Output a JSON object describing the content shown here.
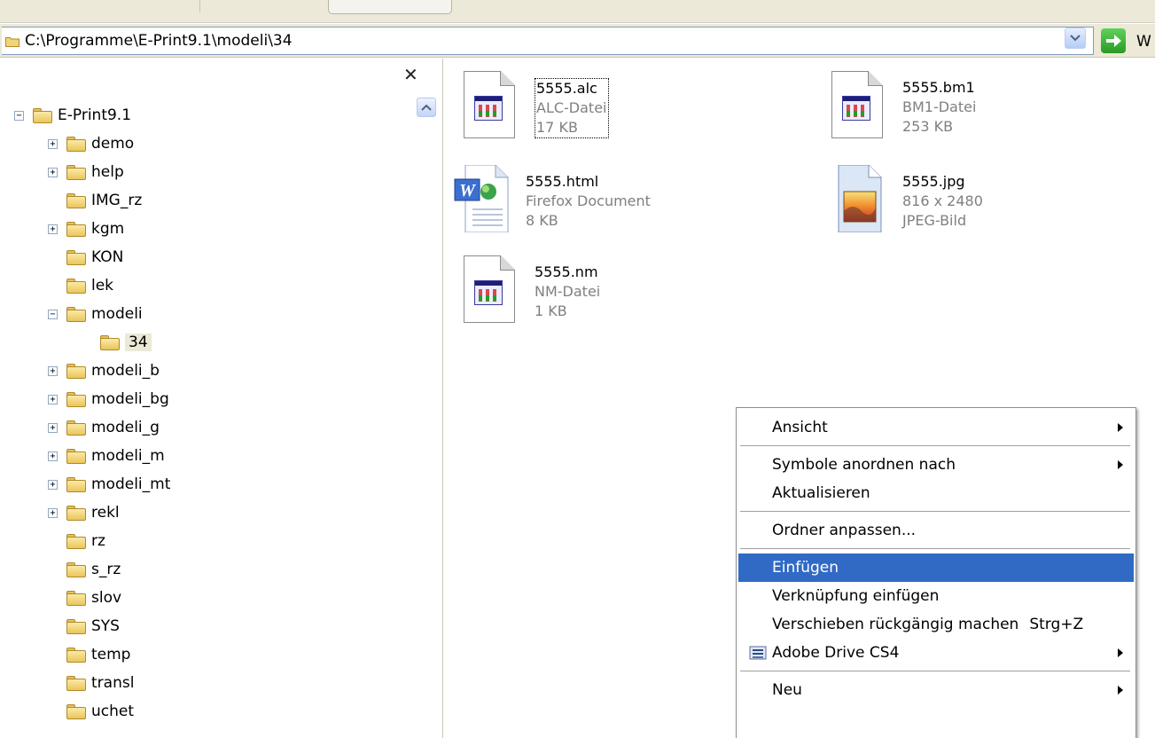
{
  "address": {
    "path": "C:\\Programme\\E-Print9.1\\modeli\\34",
    "go_label": "W"
  },
  "left_pane": {
    "close_label": "✕",
    "tree": [
      {
        "label": "E-Print9.1",
        "expander": "−",
        "level": 0
      },
      {
        "label": "demo",
        "expander": "+",
        "level": 1
      },
      {
        "label": "help",
        "expander": "+",
        "level": 1
      },
      {
        "label": "IMG_rz",
        "expander": "",
        "level": 1
      },
      {
        "label": "kgm",
        "expander": "+",
        "level": 1
      },
      {
        "label": "KON",
        "expander": "",
        "level": 1
      },
      {
        "label": "lek",
        "expander": "",
        "level": 1
      },
      {
        "label": "modeli",
        "expander": "−",
        "level": 1
      },
      {
        "label": "34",
        "expander": "",
        "level": 2,
        "selected": true
      },
      {
        "label": "modeli_b",
        "expander": "+",
        "level": 1
      },
      {
        "label": "modeli_bg",
        "expander": "+",
        "level": 1
      },
      {
        "label": "modeli_g",
        "expander": "+",
        "level": 1
      },
      {
        "label": "modeli_m",
        "expander": "+",
        "level": 1
      },
      {
        "label": "modeli_mt",
        "expander": "+",
        "level": 1
      },
      {
        "label": "rekl",
        "expander": "+",
        "level": 1
      },
      {
        "label": "rz",
        "expander": "",
        "level": 1
      },
      {
        "label": "s_rz",
        "expander": "",
        "level": 1
      },
      {
        "label": "slov",
        "expander": "",
        "level": 1
      },
      {
        "label": "SYS",
        "expander": "",
        "level": 1
      },
      {
        "label": "temp",
        "expander": "",
        "level": 1
      },
      {
        "label": "transl",
        "expander": "",
        "level": 1
      },
      {
        "label": "uchet",
        "expander": "",
        "level": 1
      }
    ]
  },
  "files": [
    {
      "name": "5555.alc",
      "type": "ALC-Datei",
      "size": "17 KB",
      "icon": "app-document-icon",
      "focused": true
    },
    {
      "name": "5555.bm1",
      "type": "BM1-Datei",
      "size": "253 KB",
      "icon": "app-document-icon"
    },
    {
      "name": "5555.html",
      "type": "Firefox Document",
      "size": "8 KB",
      "icon": "word-html-document-icon"
    },
    {
      "name": "5555.jpg",
      "type": "816 x 2480",
      "size": "JPEG-Bild",
      "icon": "jpeg-image-icon"
    },
    {
      "name": "5555.nm",
      "type": "NM-Datei",
      "size": "1 KB",
      "icon": "app-document-icon"
    }
  ],
  "context_menu": {
    "items": [
      {
        "label": "Ansicht",
        "submenu": true
      },
      {
        "separator": true
      },
      {
        "label": "Symbole anordnen nach",
        "submenu": true
      },
      {
        "label": "Aktualisieren"
      },
      {
        "separator": true
      },
      {
        "label": "Ordner anpassen..."
      },
      {
        "separator": true
      },
      {
        "label": "Einfügen",
        "highlighted": true
      },
      {
        "label": "Verknüpfung einfügen"
      },
      {
        "label": "Verschieben rückgängig machen",
        "shortcut": "Strg+Z"
      },
      {
        "label": "Adobe Drive CS4",
        "submenu": true,
        "icon": "adobe-drive-icon"
      },
      {
        "separator": true
      },
      {
        "label": "Neu",
        "submenu": true
      }
    ]
  },
  "colors": {
    "highlight": "#316ac5",
    "toolbar_bg": "#ece9d8",
    "muted_text": "#808080"
  }
}
